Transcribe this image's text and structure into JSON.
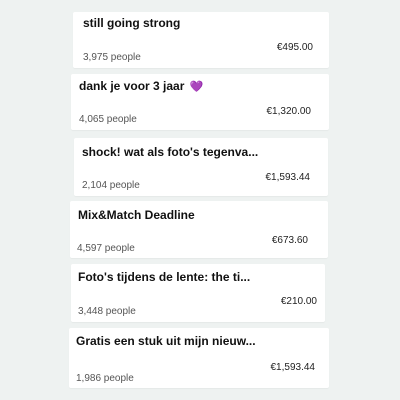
{
  "campaigns": [
    {
      "title": "still going strong",
      "people": "3,975 people",
      "amount": "€495.00"
    },
    {
      "title": "dank je voor 3 jaar",
      "emoji": "💜",
      "people": "4,065 people",
      "amount": "€1,320.00"
    },
    {
      "title": "shock! wat als foto's tegenva...",
      "people": "2,104 people",
      "amount": "€1,593.44"
    },
    {
      "title": "Mix&Match Deadline",
      "people": "4,597 people",
      "amount": "€673.60"
    },
    {
      "title": "Foto's tijdens de lente: the ti...",
      "people": "3,448 people",
      "amount": "€210.00"
    },
    {
      "title": "Gratis een stuk uit mijn nieuw...",
      "people": "1,986 people",
      "amount": "€1,593.44"
    }
  ],
  "colors": {
    "background": "#eef2f1",
    "card": "#ffffff",
    "heart": "#9b5de5"
  }
}
